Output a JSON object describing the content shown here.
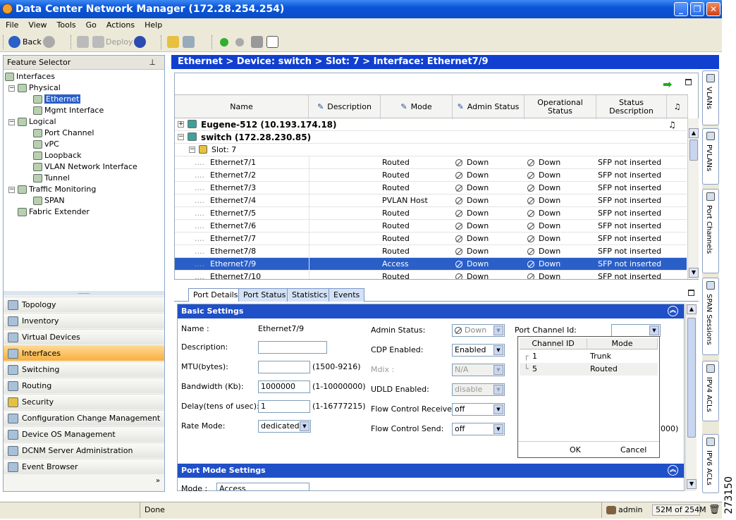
{
  "window": {
    "title": "Data Center Network Manager (172.28.254.254)"
  },
  "menu": [
    "File",
    "View",
    "Tools",
    "Go",
    "Actions",
    "Help"
  ],
  "toolbar": {
    "back": "Back",
    "deploy": "Deploy"
  },
  "feature_selector": {
    "title": "Feature Selector",
    "tree": [
      "Interfaces",
      "Physical",
      "Ethernet",
      "Mgmt Interface",
      "Logical",
      "Port Channel",
      "vPC",
      "Loopback",
      "VLAN Network Interface",
      "Tunnel",
      "Traffic Monitoring",
      "SPAN",
      "Fabric Extender"
    ]
  },
  "nav": [
    "Topology",
    "Inventory",
    "Virtual Devices",
    "Interfaces",
    "Switching",
    "Routing",
    "Security",
    "Configuration Change Management",
    "Device OS Management",
    "DCNM Server Administration",
    "Event Browser"
  ],
  "breadcrumb": "Ethernet > Device: switch > Slot: 7 > Interface: Ethernet7/9",
  "table": {
    "headers": [
      "Name",
      "Description",
      "Mode",
      "Admin Status",
      "Operational Status",
      "Status Description"
    ],
    "devices": [
      "Eugene-512 (10.193.174.18)",
      "switch (172.28.230.85)"
    ],
    "slot": "Slot: 7",
    "rows": [
      {
        "name": "Ethernet7/1",
        "mode": "Routed",
        "admin": "Down",
        "oper": "Down",
        "status": "SFP not inserted"
      },
      {
        "name": "Ethernet7/2",
        "mode": "Routed",
        "admin": "Down",
        "oper": "Down",
        "status": "SFP not inserted"
      },
      {
        "name": "Ethernet7/3",
        "mode": "Routed",
        "admin": "Down",
        "oper": "Down",
        "status": "SFP not inserted"
      },
      {
        "name": "Ethernet7/4",
        "mode": "PVLAN Host",
        "admin": "Down",
        "oper": "Down",
        "status": "SFP not inserted"
      },
      {
        "name": "Ethernet7/5",
        "mode": "Routed",
        "admin": "Down",
        "oper": "Down",
        "status": "SFP not inserted"
      },
      {
        "name": "Ethernet7/6",
        "mode": "Routed",
        "admin": "Down",
        "oper": "Down",
        "status": "SFP not inserted"
      },
      {
        "name": "Ethernet7/7",
        "mode": "Routed",
        "admin": "Down",
        "oper": "Down",
        "status": "SFP not inserted"
      },
      {
        "name": "Ethernet7/8",
        "mode": "Routed",
        "admin": "Down",
        "oper": "Down",
        "status": "SFP not inserted"
      },
      {
        "name": "Ethernet7/9",
        "mode": "Access",
        "admin": "Down",
        "oper": "Down",
        "status": "SFP not inserted"
      },
      {
        "name": "Ethernet7/10",
        "mode": "Routed",
        "admin": "Down",
        "oper": "Down",
        "status": "SFP not inserted"
      }
    ]
  },
  "tabs": [
    "Port Details",
    "Port Status",
    "Statistics",
    "Events"
  ],
  "basic": {
    "title": "Basic Settings",
    "name_label": "Name :",
    "name_value": "Ethernet7/9",
    "desc_label": "Description:",
    "mtu_label": "MTU(bytes):",
    "mtu_range": "(1500-9216)",
    "bw_label": "Bandwidth (Kb):",
    "bw_value": "1000000",
    "bw_range": "(1-10000000)",
    "delay_label": "Delay(tens of usec):",
    "delay_value": "1",
    "delay_range": "(1-16777215)",
    "rate_label": "Rate Mode:",
    "rate_value": "dedicated",
    "admin_label": "Admin Status:",
    "admin_value": "Down",
    "cdp_label": "CDP Enabled:",
    "cdp_value": "Enabled",
    "mdix_label": "Mdix :",
    "mdix_value": "N/A",
    "udld_label": "UDLD Enabled:",
    "udld_value": "disable",
    "fcr_label": "Flow Control Receive:",
    "fcr_value": "off",
    "fcs_label": "Flow Control Send:",
    "fcs_value": "off",
    "pc_label": "Port Channel Id:",
    "hidden_right": "000)"
  },
  "popup": {
    "headers": [
      "Channel ID",
      "Mode"
    ],
    "rows": [
      {
        "id": "1",
        "mode": "Trunk"
      },
      {
        "id": "5",
        "mode": "Routed"
      }
    ],
    "ok": "OK",
    "cancel": "Cancel"
  },
  "port_mode": {
    "title": "Port Mode Settings",
    "mode_label": "Mode :",
    "mode_value": "Access"
  },
  "side_tabs": [
    "VLANs",
    "PVLANs",
    "Port Channels",
    "SPAN Sessions",
    "IPV4 ACLs",
    "IPV6 ACLs"
  ],
  "status": {
    "text": "Done",
    "user": "admin",
    "memory": "52M of 254M"
  },
  "figure_id": "273150"
}
